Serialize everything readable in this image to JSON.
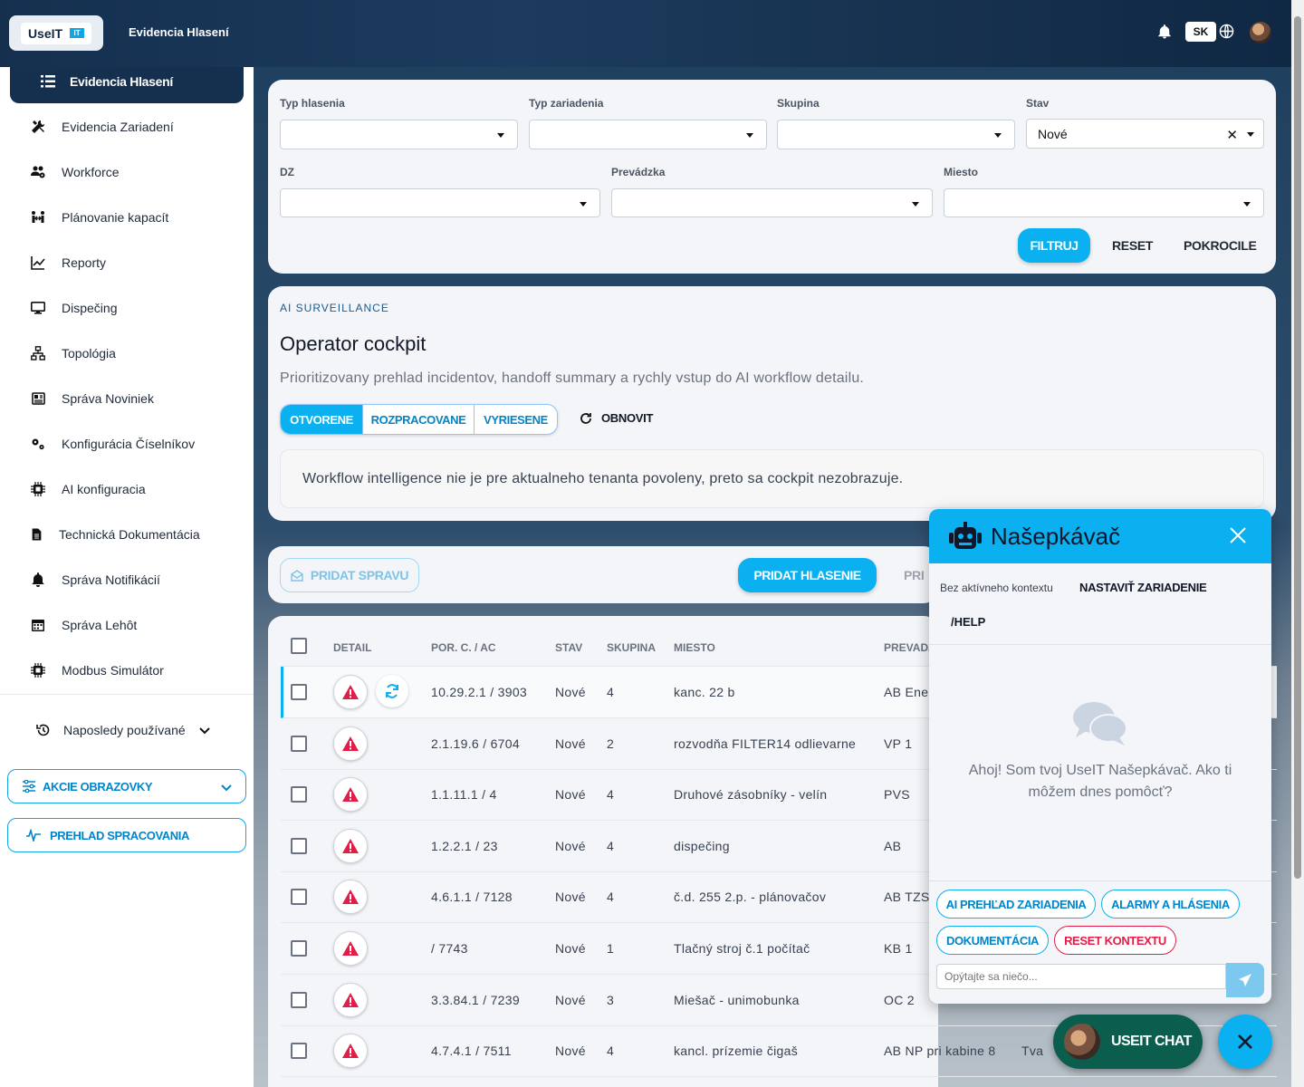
{
  "header": {
    "logo_text": "UseIT",
    "logo_badge": "IT",
    "app_title": "Evidencia Hlasení",
    "language": "SK"
  },
  "sidebar": {
    "active": "Evidencia Hlasení",
    "items": [
      {
        "label": "Evidencia Zariadení",
        "icon": "tools-icon"
      },
      {
        "label": "Workforce",
        "icon": "users-cog-icon"
      },
      {
        "label": "Plánovanie kapacít",
        "icon": "people-arrows-icon"
      },
      {
        "label": "Reporty",
        "icon": "chart-line-icon"
      },
      {
        "label": "Dispečing",
        "icon": "desktop-icon"
      },
      {
        "label": "Topológia",
        "icon": "sitemap-icon"
      },
      {
        "label": "Správa Noviniek",
        "icon": "newspaper-icon"
      },
      {
        "label": "Konfigurácia Číselníkov",
        "icon": "cogs-icon"
      },
      {
        "label": "AI konfiguracia",
        "icon": "chip-icon"
      },
      {
        "label": "Technická Dokumentácia",
        "icon": "file-icon"
      },
      {
        "label": "Správa Notifikácií",
        "icon": "bell-icon"
      },
      {
        "label": "Správa Lehôt",
        "icon": "calendar-icon"
      },
      {
        "label": "Modbus Simulátor",
        "icon": "chip-icon"
      }
    ],
    "recent": "Naposledy používané",
    "screen_actions": "AKCIE OBRAZOVKY",
    "processing_overview": "PREHLAD SPRACOVANIA"
  },
  "filters": {
    "typ_hlasenia": {
      "label": "Typ hlasenia",
      "value": ""
    },
    "typ_zariadenia": {
      "label": "Typ zariadenia",
      "value": ""
    },
    "skupina": {
      "label": "Skupina",
      "value": ""
    },
    "stav": {
      "label": "Stav",
      "value": "Nové"
    },
    "dz": {
      "label": "DZ",
      "value": ""
    },
    "prevadzka": {
      "label": "Prevádzka",
      "value": ""
    },
    "miesto": {
      "label": "Miesto",
      "value": ""
    },
    "filter_btn": "FILTRUJ",
    "reset_btn": "RESET",
    "advanced_btn": "POKROCILE"
  },
  "ai": {
    "eyebrow": "AI SURVEILLANCE",
    "title": "Operator cockpit",
    "description": "Prioritizovany prehlad incidentov, handoff summary a rychly vstup do AI workflow detailu.",
    "tabs": [
      "OTVORENE",
      "ROZPRACOVANE",
      "VYRIESENE"
    ],
    "refresh": "OBNOVIT",
    "notice": "Workflow intelligence nie je pre aktualneho tenanta povoleny, preto sa cockpit nezobrazuje."
  },
  "actions": {
    "add_message": "PRIDAT SPRAVU",
    "add_report": "PRIDAT HLASENIE",
    "truncated": "PRI"
  },
  "table": {
    "headers": [
      "DETAIL",
      "POR. C. / AC",
      "STAV",
      "SKUPINA",
      "MIESTO",
      "PREVADZ"
    ],
    "rows": [
      {
        "por": "10.29.2.1 / 3903",
        "stav": "Nové",
        "skupina": "4",
        "miesto": "kanc. 22 b",
        "prevadzka": "AB Ene",
        "extra": ""
      },
      {
        "por": "2.1.19.6 / 6704",
        "stav": "Nové",
        "skupina": "2",
        "miesto": "rozvodňa FILTER14 odlievarne",
        "prevadzka": "VP 1",
        "extra": ""
      },
      {
        "por": "1.1.11.1 / 4",
        "stav": "Nové",
        "skupina": "4",
        "miesto": "Druhové zásobníky - velín",
        "prevadzka": "PVS",
        "extra": ""
      },
      {
        "por": "1.2.2.1 / 23",
        "stav": "Nové",
        "skupina": "4",
        "miesto": "dispečing",
        "prevadzka": "AB",
        "extra": ""
      },
      {
        "por": "4.6.1.1 / 7128",
        "stav": "Nové",
        "skupina": "4",
        "miesto": "č.d. 255 2.p. - plánovačov",
        "prevadzka": "AB TZS",
        "extra": ""
      },
      {
        "por": "/ 7743",
        "stav": "Nové",
        "skupina": "1",
        "miesto": "Tlačný stroj č.1 počítač",
        "prevadzka": "KB 1",
        "extra": ""
      },
      {
        "por": "3.3.84.1 / 7239",
        "stav": "Nové",
        "skupina": "3",
        "miesto": "Miešač - unimobunka",
        "prevadzka": "OC 2",
        "extra": ""
      },
      {
        "por": "4.7.4.1 / 7511",
        "stav": "Nové",
        "skupina": "4",
        "miesto": "kancl. prízemie čigaš",
        "prevadzka": "AB NP pri kabine 8",
        "extra": "Tva"
      }
    ]
  },
  "chat": {
    "title": "Našepkávač",
    "context_label": "Bez aktívneho kontextu",
    "context_button": "NASTAVIŤ ZARIADENIE",
    "help": "/HELP",
    "greeting": "Ahoj! Som tvoj UseIT Našepkávač. Ako ti môžem dnes pomôcť?",
    "chips": [
      "AI PREHĽAD ZARIADENIA",
      "ALARMY A HLÁSENIA",
      "DOKUMENTÁCIA",
      "RESET KONTEXTU"
    ],
    "input_placeholder": "Opýtajte sa niečo...",
    "launcher": "USEIT CHAT"
  },
  "colors": {
    "accent": "#0ab0f0",
    "navy": "#15304f",
    "danger": "#e11d48",
    "chat_green": "#0b5e4e"
  }
}
